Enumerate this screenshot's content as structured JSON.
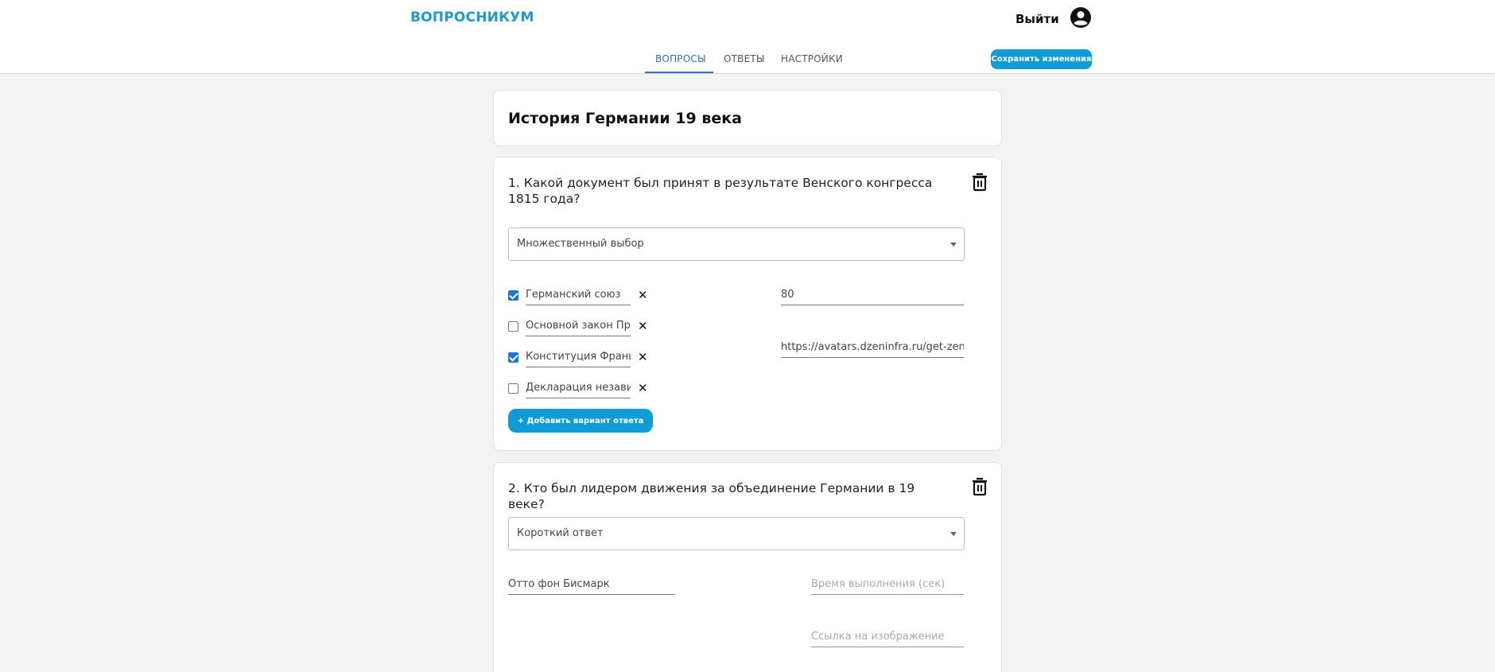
{
  "header": {
    "logo": "ВОПРОСНИКУМ",
    "logout": "Выйти",
    "tabs": [
      "ВОПРОСЫ",
      "ОТВЕТЫ",
      "НАСТРОЙКИ"
    ],
    "active_tab": "ВОПРОСЫ",
    "save_label": "Сохранить изменения",
    "accent_color": "#0e9bd7"
  },
  "survey": {
    "title": "История Германии 19 века"
  },
  "questions": [
    {
      "text": "1. Какой документ был принят в результате Венского конгресса 1815 года?",
      "type": "Множественный выбор",
      "options": [
        {
          "text": "Германский союз",
          "checked": true
        },
        {
          "text": "Основной закон Пру",
          "checked": false
        },
        {
          "text": "Конституция Франци",
          "checked": true
        },
        {
          "text": "Декларация независ",
          "checked": false
        }
      ],
      "time": "80",
      "image_url": "https://avatars.dzeninfra.ru/get-zen_dc",
      "add_option_label": "+ Добавить вариант ответа"
    },
    {
      "text": "2. Кто был лидером движения за объединение Германии в 19 веке?",
      "type": "Короткий ответ",
      "answer": "Отто фон Бисмарк",
      "time_placeholder": "Время выполнения (сек)",
      "image_placeholder": "Ссылка на изображение"
    }
  ]
}
